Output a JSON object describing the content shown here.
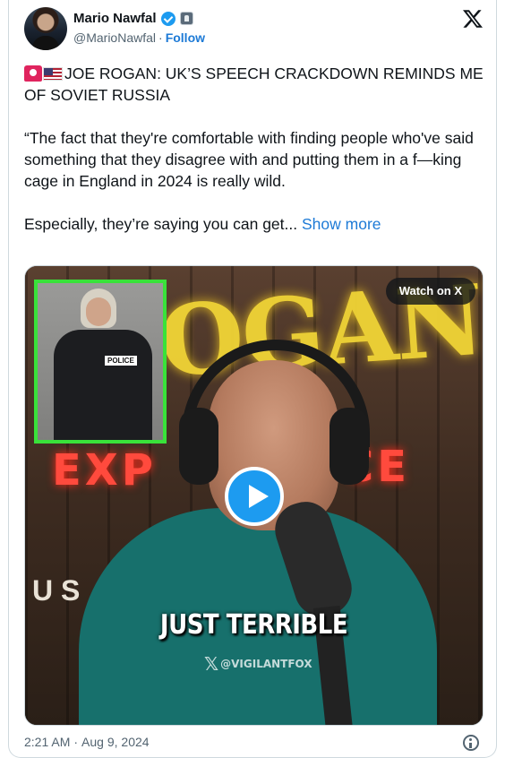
{
  "author": {
    "display_name": "Mario Nawfal",
    "handle": "@MarioNawfal",
    "separator": "·",
    "follow_label": "Follow",
    "verified_badge": "verified-check-icon",
    "affiliate_badge": "affiliate-badge-icon",
    "avatar_icon": "avatar"
  },
  "platform_logo": "x-logo-icon",
  "tweet": {
    "emoji": [
      "police-siren-icon",
      "us-flag-icon"
    ],
    "headline": "JOE ROGAN: UK’S SPEECH CRACKDOWN REMINDS ME OF SOVIET RUSSIA",
    "paragraph_1": "“The fact that they're comfortable with finding people who've said something that they disagree with and putting them in a f—king cage in England in 2024 is really wild.",
    "paragraph_2": "Especially, they’re saying you can get...",
    "show_more_label": "Show more"
  },
  "media": {
    "watch_label": "Watch on X",
    "play_icon": "play-icon",
    "caption": "JUST TERRIBLE",
    "watermark": "@VIGILANTFOX",
    "sign_top": "OGAN",
    "sign_left": "EXP",
    "sign_right": "CE",
    "sign_bottom": "U S",
    "inset_patch": "POLICE",
    "inset_border_color": "#39e23a",
    "sign_color": "#f2d536",
    "neon_color": "#ff4a3d"
  },
  "footer": {
    "time": "2:21 AM",
    "separator": "·",
    "date": "Aug 9, 2024",
    "info_icon": "info-icon"
  },
  "colors": {
    "link": "#1d7ad6",
    "verified": "#1d9bf0",
    "text": "#0f1419",
    "muted": "#536471"
  }
}
